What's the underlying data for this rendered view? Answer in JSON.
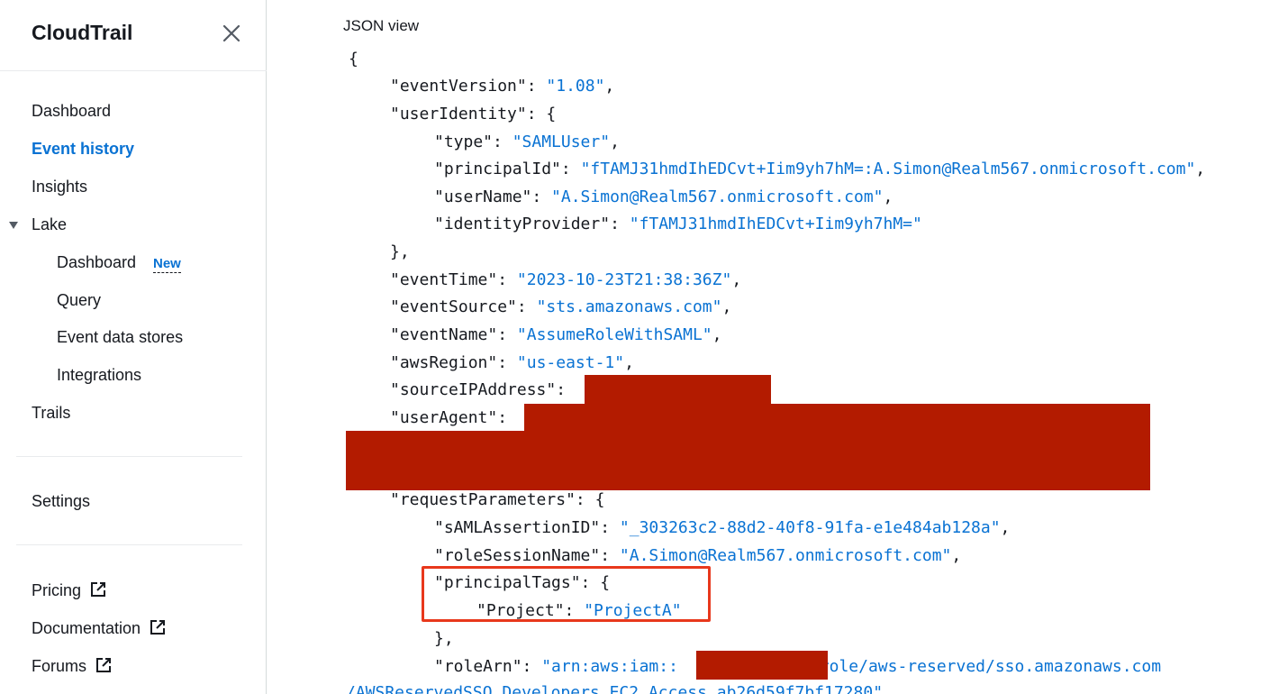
{
  "sidebar": {
    "title": "CloudTrail",
    "nav": {
      "dashboard": "Dashboard",
      "event_history": "Event history",
      "insights": "Insights",
      "lake": "Lake",
      "lake_dashboard": "Dashboard",
      "lake_dashboard_badge": "New",
      "query": "Query",
      "event_data_stores": "Event data stores",
      "integrations": "Integrations",
      "trails": "Trails",
      "settings": "Settings",
      "pricing": "Pricing",
      "documentation": "Documentation",
      "forums": "Forums"
    },
    "active_item": "Event history",
    "accent_color": "#0972d3"
  },
  "json_view": {
    "title": "JSON view",
    "lines": {
      "l0": "{",
      "l1k": "\"eventVersion\": ",
      "l1v": "\"1.08\"",
      "l1e": ",",
      "l2k": "\"userIdentity\": {",
      "l3k": "\"type\": ",
      "l3v": "\"SAMLUser\"",
      "l3e": ",",
      "l4k": "\"principalId\": ",
      "l4v": "\"fTAMJ31hmdIhEDCvt+Iim9yh7hM=:A.Simon@Realm567.onmicrosoft.com\"",
      "l4e": ",",
      "l5k": "\"userName\": ",
      "l5v": "\"A.Simon@Realm567.onmicrosoft.com\"",
      "l5e": ",",
      "l6k": "\"identityProvider\": ",
      "l6v": "\"fTAMJ31hmdIhEDCvt+Iim9yh7hM=\"",
      "l7k": "},",
      "l8k": "\"eventTime\": ",
      "l8v": "\"2023-10-23T21:38:36Z\"",
      "l8e": ",",
      "l9k": "\"eventSource\": ",
      "l9v": "\"sts.amazonaws.com\"",
      "l9e": ",",
      "l10k": "\"eventName\": ",
      "l10v": "\"AssumeRoleWithSAML\"",
      "l10e": ",",
      "l11k": "\"awsRegion\": ",
      "l11v": "\"us-east-1\"",
      "l11e": ",",
      "l12k": "\"sourceIPAddress\":",
      "l13k": "\"userAgent\":",
      "l14k": "\"requestParameters\": {",
      "l15k": "\"sAMLAssertionID\": ",
      "l15v": "\"_303263c2-88d2-40f8-91fa-e1e484ab128a\"",
      "l15e": ",",
      "l16k": "\"roleSessionName\": ",
      "l16v": "\"A.Simon@Realm567.onmicrosoft.com\"",
      "l16e": ",",
      "l17k": "\"principalTags\": {",
      "l18k": "\"Project\": ",
      "l18v": "\"ProjectA\"",
      "l19k": "},",
      "l20k": "\"roleArn\": ",
      "l20v1": "\"arn:aws:iam::",
      "l20v2": ":role/aws-reserved/sso.amazonaws.com",
      "l21v": "/AWSReservedSSO_Developers_EC2_Access_ab26d59f7bf17280\""
    },
    "string_color": "#0972d3",
    "redaction_color": "#b31b00",
    "highlight_color": "#e8381c"
  }
}
